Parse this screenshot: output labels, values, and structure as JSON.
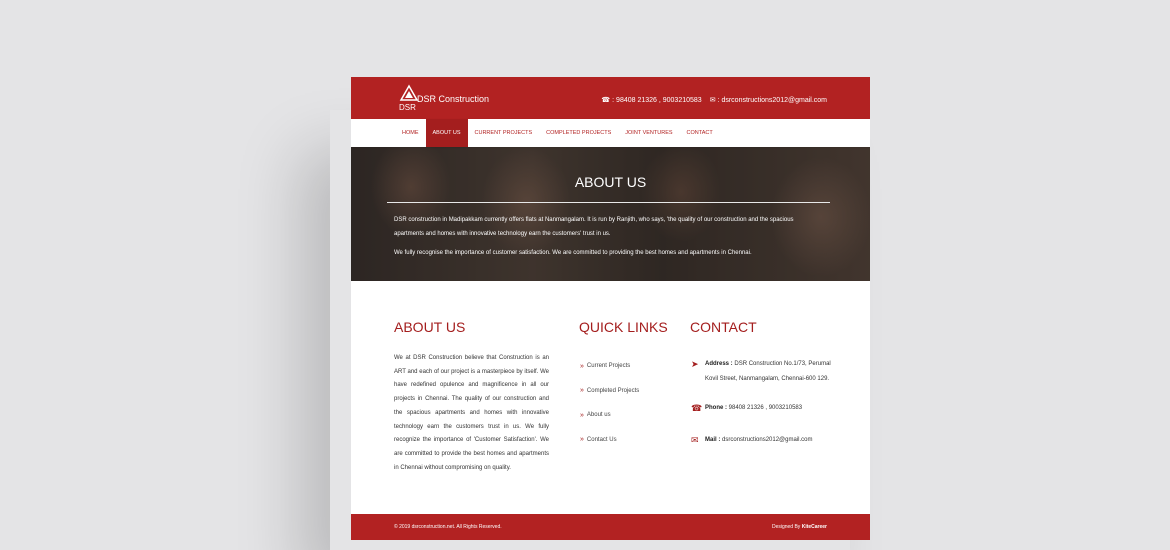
{
  "brand": {
    "logo_text": "DSR",
    "name": "DSR Construction"
  },
  "topbar": {
    "phone": ": 98408 21326 , 9003210583",
    "email": ": dsrconstructions2012@gmail.com"
  },
  "nav": [
    "HOME",
    "ABOUT US",
    "CURRENT PROJECTS",
    "COMPLETED PROJECTS",
    "JOINT VENTURES",
    "CONTACT"
  ],
  "hero": {
    "title": "ABOUT US",
    "p1": "DSR construction in Madipakkam currently offers flats at Nanmangalam. It is run by Ranjith, who says, 'the quality of our construction and the spacious apartments and homes with innovative technology earn the customers' trust in us.",
    "p2": "We fully recognise the importance of customer satisfaction. We are committed to providing the best homes and apartments in Chennai."
  },
  "about": {
    "heading": "ABOUT US",
    "text": "We at DSR Construction believe that Construction is an ART and each of our project is a masterpiece by itself. We have redefined opulence and magnificence in all our projects in Chennai. The quality of our construction and the spacious apartments and homes with innovative technology earn the customers trust in us. We fully recognize the importance of 'Customer Satisfaction'. We are committed to provide the best homes and apartments in Chennai without compromising on quality."
  },
  "quick_links": {
    "heading": "QUICK LINKS",
    "items": [
      "Current Projects",
      "Completed Projects",
      "About us",
      "Contact Us"
    ]
  },
  "contact": {
    "heading": "CONTACT",
    "address_label": "Address :",
    "address": "DSR Construction No.1/73, Perumal Kovil Street, Nanmangalam, Chennai-600 129.",
    "phone_label": "Phone :",
    "phone": "98408 21326 , 9003210583",
    "mail_label": "Mail :",
    "mail": "dsrconstructions2012@gmail.com"
  },
  "footer": {
    "copyright": "© 2019 dsrconstruction.net. All Rights Reserved.",
    "designed_prefix": "Designed By",
    "designed_by": "KiteCareer"
  },
  "colors": {
    "brand_red": "#b22222",
    "background": "#e4e4e6"
  }
}
